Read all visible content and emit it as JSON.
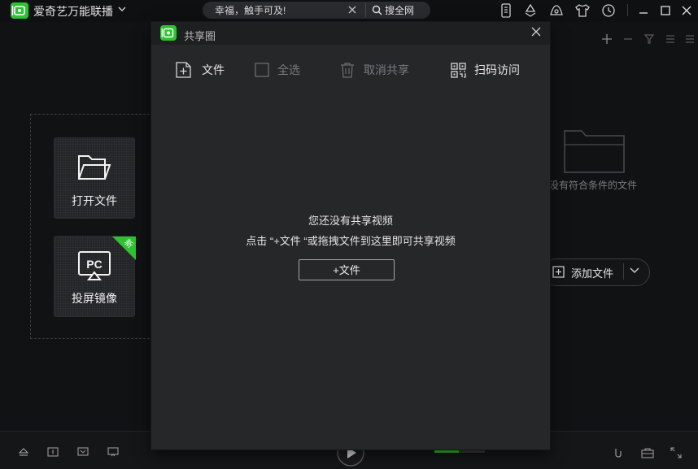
{
  "app": {
    "title": "爱奇艺万能联播",
    "search_text": "幸福，触手可及!",
    "search_button_label": "搜全网",
    "accent_color": "#2ec230"
  },
  "titlebar_icons": [
    "phone-icon",
    "recycle-icon",
    "skin-icon",
    "shirt-icon",
    "history-icon",
    "minimize-icon",
    "maximize-icon",
    "close-icon"
  ],
  "background": {
    "tiles": [
      {
        "label": "打开文件",
        "icon": "folder-icon"
      },
      {
        "label": "投屏镜像",
        "icon": "screen-mirror-icon",
        "badge": "新"
      }
    ],
    "empty_text": "没有符合条件的文件",
    "add_file_label": "添加文件"
  },
  "dialog": {
    "title": "共享圈",
    "toolbar": {
      "file_label": "文件",
      "select_all_label": "全选",
      "unshare_label": "取消共享",
      "scan_label": "扫码访问"
    },
    "empty_title": "您还没有共享视频",
    "empty_hint": "点击 “+文件 “或拖拽文件到这里即可共享视频",
    "add_button_label": "+文件"
  }
}
